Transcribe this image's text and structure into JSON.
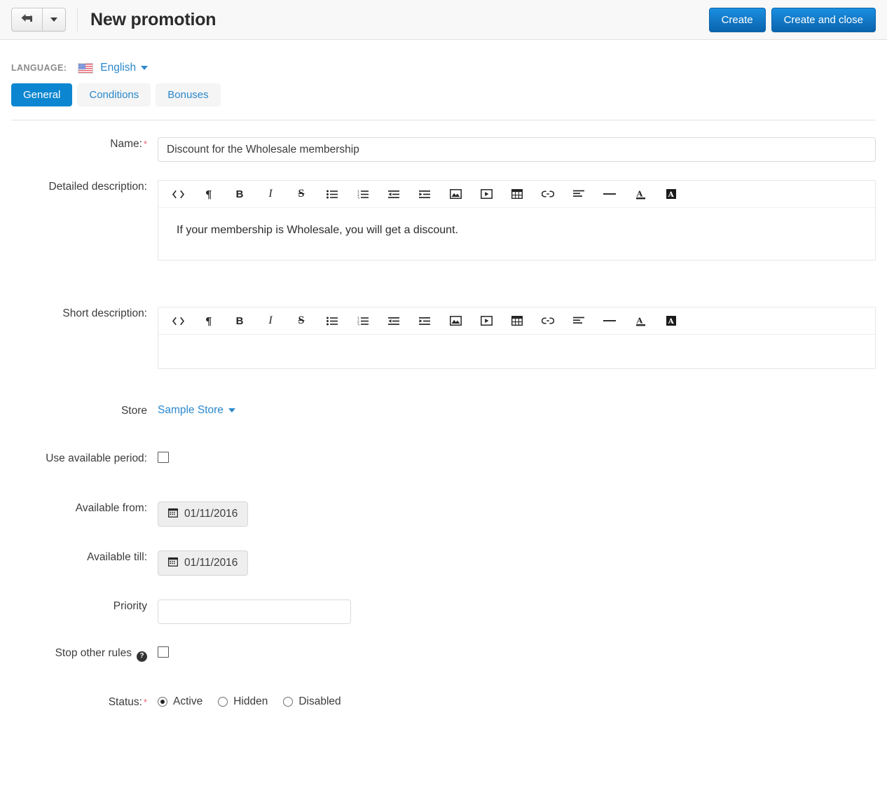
{
  "header": {
    "title": "New promotion",
    "back_icon": "back-arrow-icon",
    "back_caret_icon": "chevron-down-icon",
    "create_label": "Create",
    "create_and_close_label": "Create and close",
    "accent_color": "#0a63ad"
  },
  "language": {
    "label": "LANGUAGE:",
    "flag_icon": "us-flag-icon",
    "value": "English",
    "caret_icon": "caret-down-icon",
    "link_color": "#2a88cc"
  },
  "tabs": [
    {
      "label": "General",
      "active": true
    },
    {
      "label": "Conditions",
      "active": false
    },
    {
      "label": "Bonuses",
      "active": false
    }
  ],
  "form": {
    "name": {
      "label": "Name:",
      "required": "*",
      "value": "Discount for the Wholesale membership",
      "placeholder": ""
    },
    "detailed_description": {
      "label": "Detailed description:",
      "content": "If your membership is Wholesale, you will get a discount."
    },
    "short_description": {
      "label": "Short description:",
      "content": ""
    },
    "store": {
      "label": "Store",
      "value": "Sample Store",
      "caret_icon": "caret-down-icon"
    },
    "use_available_period": {
      "label": "Use available period:",
      "checked": false
    },
    "available_from": {
      "label": "Available from:",
      "value": "01/11/2016",
      "icon": "calendar-icon"
    },
    "available_till": {
      "label": "Available till:",
      "value": "01/11/2016",
      "icon": "calendar-icon"
    },
    "priority": {
      "label": "Priority",
      "value": "",
      "placeholder": ""
    },
    "stop_other_rules": {
      "label": "Stop other rules",
      "help_icon": "help-circle-icon",
      "help_glyph": "?",
      "checked": false
    },
    "status": {
      "label": "Status:",
      "required": "*",
      "options": [
        {
          "label": "Active",
          "checked": true
        },
        {
          "label": "Hidden",
          "checked": false
        },
        {
          "label": "Disabled",
          "checked": false
        }
      ]
    }
  },
  "editor_toolbar": [
    {
      "name": "source-code-icon",
      "title": "Code view"
    },
    {
      "name": "paragraph-icon",
      "title": "Paragraph"
    },
    {
      "name": "bold-icon",
      "title": "Bold"
    },
    {
      "name": "italic-icon",
      "title": "Italic"
    },
    {
      "name": "strikethrough-icon",
      "title": "Strikethrough"
    },
    {
      "name": "bullet-list-icon",
      "title": "Unordered list"
    },
    {
      "name": "numbered-list-icon",
      "title": "Ordered list"
    },
    {
      "name": "outdent-icon",
      "title": "Decrease indent"
    },
    {
      "name": "indent-icon",
      "title": "Increase indent"
    },
    {
      "name": "image-icon",
      "title": "Insert image"
    },
    {
      "name": "video-icon",
      "title": "Insert video"
    },
    {
      "name": "table-icon",
      "title": "Insert table"
    },
    {
      "name": "link-icon",
      "title": "Insert link"
    },
    {
      "name": "align-left-icon",
      "title": "Align"
    },
    {
      "name": "horizontal-rule-icon",
      "title": "Horizontal line"
    },
    {
      "name": "font-color-icon",
      "title": "Font color"
    },
    {
      "name": "highlight-color-icon",
      "title": "Background color"
    }
  ]
}
